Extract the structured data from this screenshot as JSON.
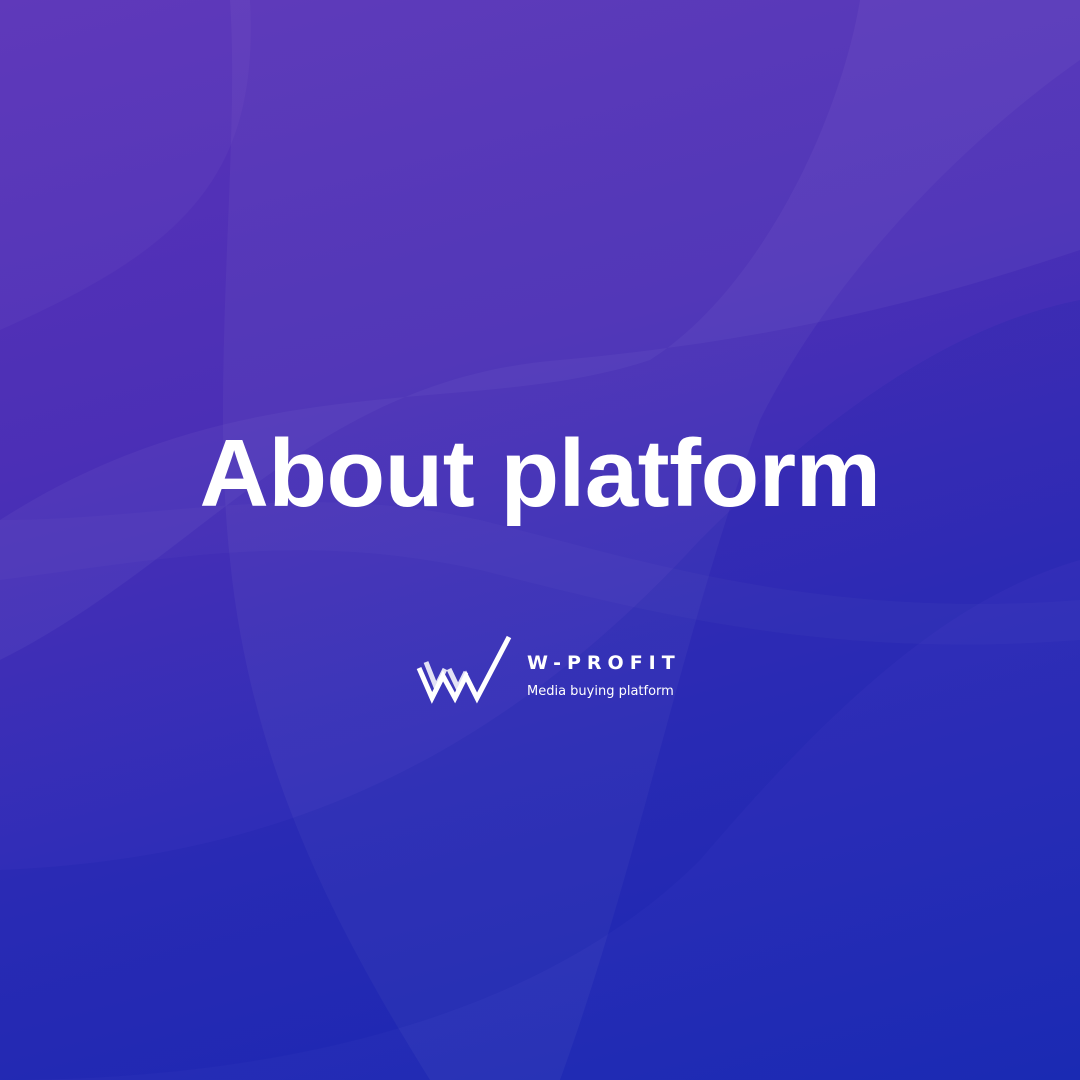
{
  "title": "About platform",
  "brand": {
    "name": "W-PROFIT",
    "tagline": "Media buying platform",
    "logo_icon": "w-checkmark-logo-icon"
  },
  "colors": {
    "background_top": "#5a33b8",
    "background_bottom": "#1a2ab3",
    "text": "#ffffff"
  }
}
